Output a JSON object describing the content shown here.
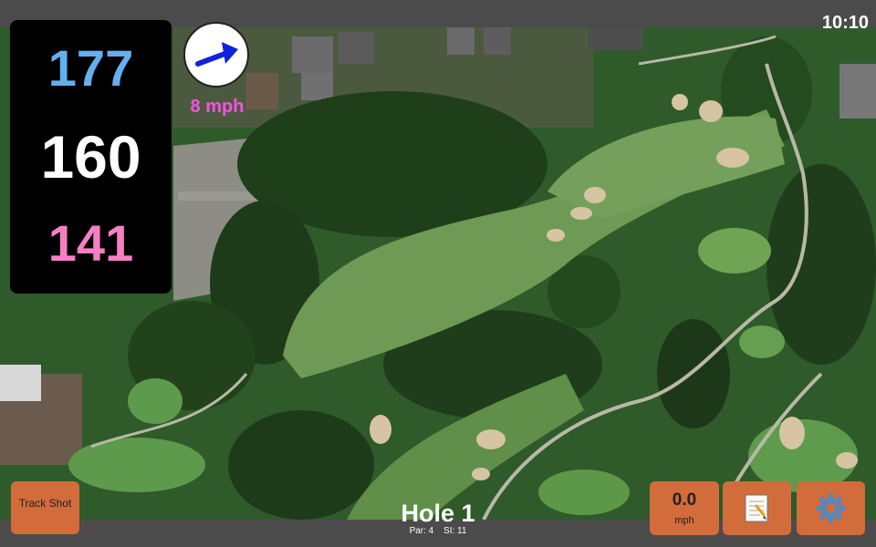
{
  "clock": "10:10",
  "distances": {
    "back": "177",
    "middle": "160",
    "front": "141"
  },
  "wind": {
    "speed": "8 mph"
  },
  "buttons": {
    "track_shot": "Track Shot",
    "speed_value": "0.0",
    "speed_unit": "mph"
  },
  "hole": {
    "title": "Hole 1",
    "par": "Par: 4",
    "stroke_index": "SI: 11"
  },
  "icons": {
    "wind_arrow": "arrow-icon",
    "notes": "notepad-icon",
    "settings": "gear-icon"
  },
  "colors": {
    "back": "#64b0ef",
    "middle": "#ffffff",
    "front": "#f67fc4",
    "button": "#d26c3b",
    "wind_text": "#ff4fe3"
  }
}
